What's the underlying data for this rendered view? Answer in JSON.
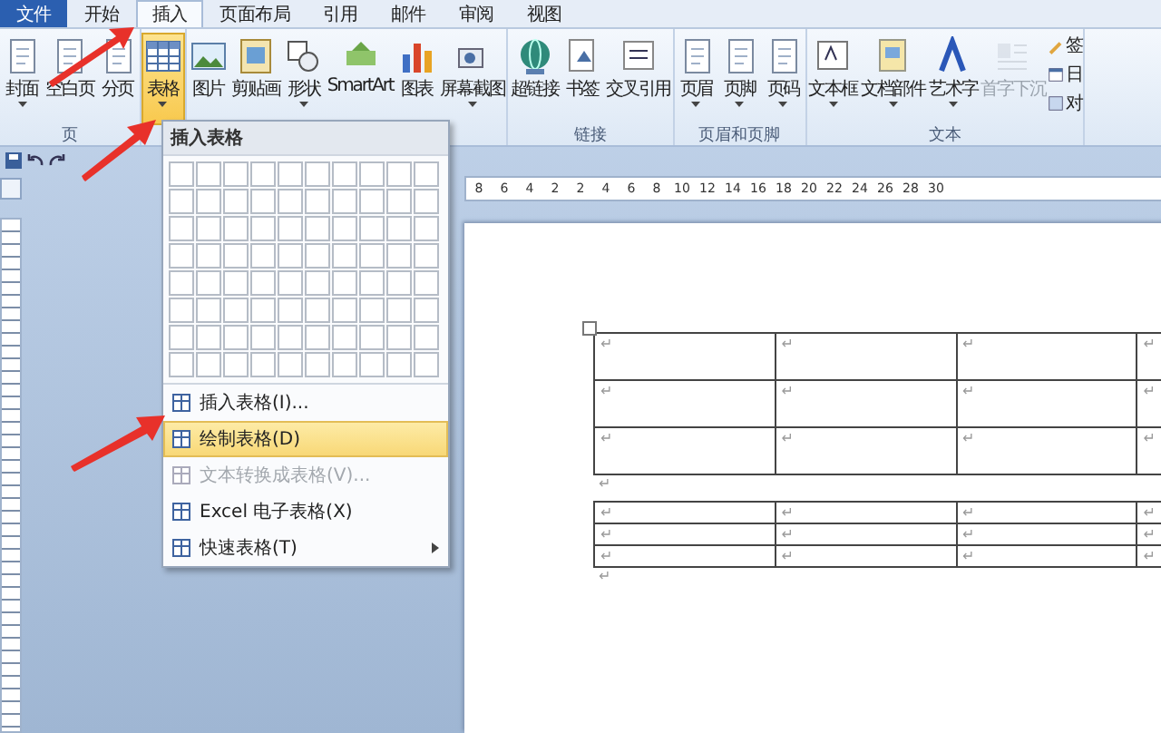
{
  "menu_tabs": [
    {
      "label": "文件",
      "kind": "file",
      "selected": false
    },
    {
      "label": "开始",
      "kind": "tab",
      "selected": false
    },
    {
      "label": "插入",
      "kind": "tab",
      "selected": true
    },
    {
      "label": "页面布局",
      "kind": "tab",
      "selected": false
    },
    {
      "label": "引用",
      "kind": "tab",
      "selected": false
    },
    {
      "label": "邮件",
      "kind": "tab",
      "selected": false
    },
    {
      "label": "审阅",
      "kind": "tab",
      "selected": false
    },
    {
      "label": "视图",
      "kind": "tab",
      "selected": false
    }
  ],
  "ribbon_groups": [
    {
      "label": "页",
      "buttons": [
        {
          "label": "封面",
          "kind": "large",
          "dropdown": true,
          "pressed": false,
          "disabled": false
        },
        {
          "label": "空白页",
          "kind": "large",
          "dropdown": false,
          "pressed": false,
          "disabled": false
        },
        {
          "label": "分页",
          "kind": "large",
          "dropdown": false,
          "pressed": false,
          "disabled": false
        }
      ]
    },
    {
      "buttons": [
        {
          "label": "表格",
          "kind": "large",
          "dropdown": true,
          "pressed": true,
          "disabled": false
        }
      ]
    },
    {
      "buttons": [
        {
          "label": "图片",
          "kind": "large",
          "dropdown": false,
          "pressed": false,
          "disabled": false
        },
        {
          "label": "剪贴画",
          "kind": "large",
          "dropdown": false,
          "pressed": false,
          "disabled": false
        },
        {
          "label": "形状",
          "kind": "large",
          "dropdown": true,
          "pressed": false,
          "disabled": false
        },
        {
          "label": "SmartArt",
          "kind": "large",
          "dropdown": false,
          "pressed": false,
          "disabled": false
        },
        {
          "label": "图表",
          "kind": "large",
          "dropdown": false,
          "pressed": false,
          "disabled": false
        },
        {
          "label": "屏幕截图",
          "kind": "large",
          "dropdown": true,
          "pressed": false,
          "disabled": false
        }
      ]
    },
    {
      "label": "链接",
      "buttons": [
        {
          "label": "超链接",
          "kind": "large",
          "dropdown": false,
          "pressed": false,
          "disabled": false
        },
        {
          "label": "书签",
          "kind": "large",
          "dropdown": false,
          "pressed": false,
          "disabled": false
        },
        {
          "label": "交叉引用",
          "kind": "large",
          "dropdown": false,
          "pressed": false,
          "disabled": false
        }
      ]
    },
    {
      "label": "页眉和页脚",
      "buttons": [
        {
          "label": "页眉",
          "kind": "large",
          "dropdown": true,
          "pressed": false,
          "disabled": false
        },
        {
          "label": "页脚",
          "kind": "large",
          "dropdown": true,
          "pressed": false,
          "disabled": false
        },
        {
          "label": "页码",
          "kind": "large",
          "dropdown": true,
          "pressed": false,
          "disabled": false
        }
      ]
    },
    {
      "label": "文本",
      "buttons": [
        {
          "label": "文本框",
          "kind": "large",
          "dropdown": true,
          "pressed": false,
          "disabled": false
        },
        {
          "label": "文档部件",
          "kind": "large",
          "dropdown": true,
          "pressed": false,
          "disabled": false
        },
        {
          "label": "艺术字",
          "kind": "large",
          "dropdown": true,
          "pressed": false,
          "disabled": false
        },
        {
          "label": "首字下沉",
          "kind": "large",
          "dropdown": false,
          "pressed": false,
          "disabled": true
        },
        {
          "label": "签",
          "kind": "small"
        },
        {
          "label": "日",
          "kind": "small"
        },
        {
          "label": "对",
          "kind": "small"
        }
      ]
    }
  ],
  "ruler": {
    "numbers": [
      "8",
      "6",
      "4",
      "2",
      "2",
      "4",
      "6",
      "8",
      "10",
      "12",
      "14",
      "16",
      "18",
      "20",
      "22",
      "24",
      "26",
      "28",
      "30"
    ]
  },
  "document": {
    "tables": [
      {
        "kind": "tall",
        "rows": [
          [
            "↵",
            "↵",
            "↵",
            "↵"
          ],
          [
            "↵",
            "↵",
            "↵",
            "↵"
          ],
          [
            "↵",
            "↵",
            "↵",
            "↵"
          ]
        ],
        "after": "↵"
      },
      {
        "kind": "short",
        "rows": [
          [
            "↵",
            "↵",
            "↵",
            "↵"
          ],
          [
            "↵",
            "↵",
            "↵",
            "↵"
          ],
          [
            "↵",
            "↵",
            "↵",
            "↵"
          ]
        ],
        "after": "↵"
      }
    ]
  },
  "table_menu": {
    "title": "插入表格",
    "items": [
      {
        "label": "插入表格(I)...",
        "selected": false,
        "disabled": false,
        "submenu": false
      },
      {
        "label": "绘制表格(D)",
        "selected": true,
        "disabled": false,
        "submenu": false
      },
      {
        "label": "文本转换成表格(V)...",
        "selected": false,
        "disabled": true,
        "submenu": false
      },
      {
        "label": "Excel 电子表格(X)",
        "selected": false,
        "disabled": false,
        "submenu": false
      },
      {
        "label": "快速表格(T)",
        "selected": false,
        "disabled": false,
        "submenu": true
      }
    ]
  }
}
